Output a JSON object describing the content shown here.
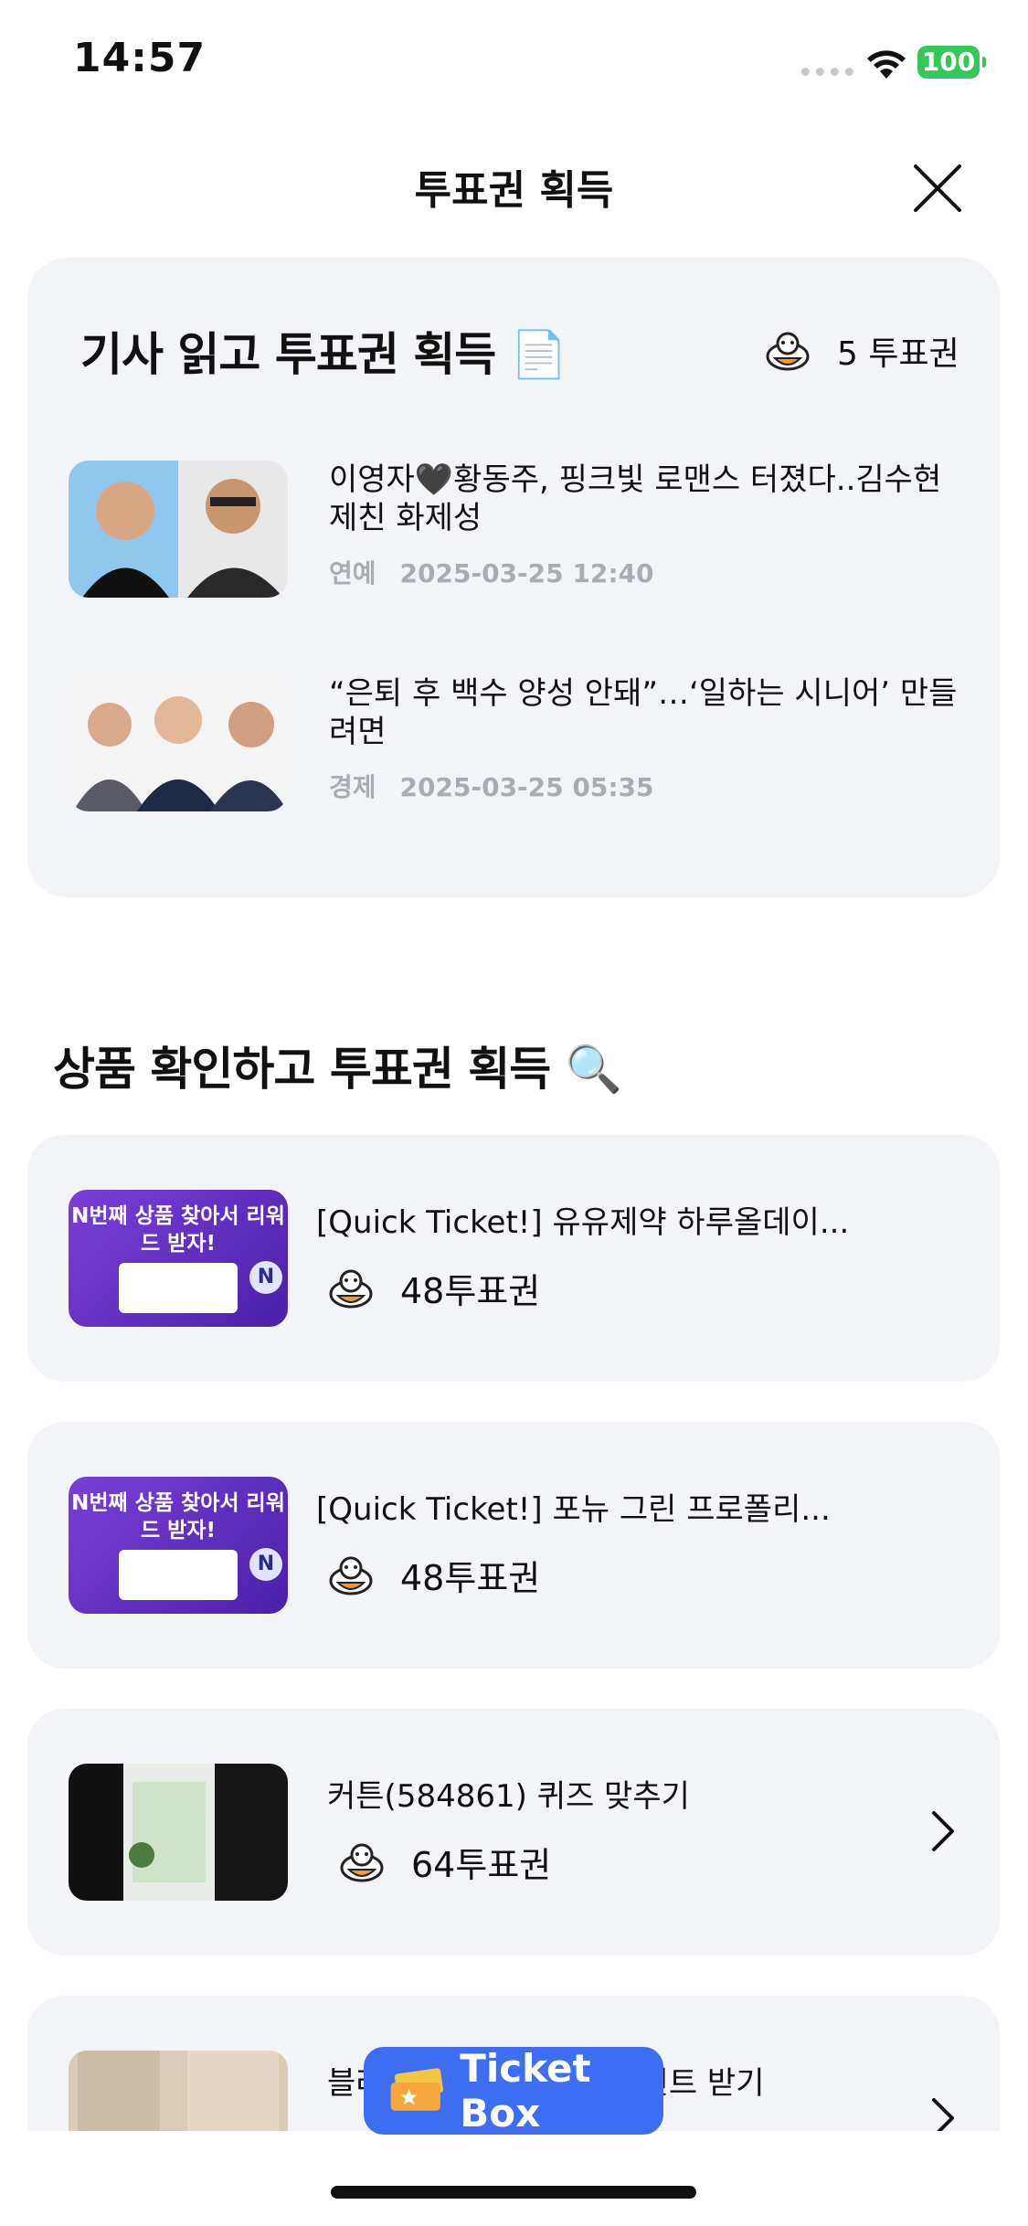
{
  "status": {
    "time": "14:57",
    "battery": "100"
  },
  "header": {
    "title": "투표권 획득"
  },
  "articles_section": {
    "title": "기사 읽고 투표권 획득 📄",
    "reward": "5 투표권",
    "items": [
      {
        "title": "이영자🖤황동주, 핑크빛 로맨스 터졌다..김수현 제친 화제성",
        "category": "연예",
        "datetime": "2025-03-25 12:40"
      },
      {
        "title": "“은퇴 후 백수 양성 안돼”…‘일하는 시니어’ 만들려면",
        "category": "경제",
        "datetime": "2025-03-25 05:35"
      }
    ]
  },
  "products_section": {
    "title": "상품 확인하고 투표권 획득 🔍",
    "promo_text": "N번째 상품 찾아서 리워드 받자!",
    "items": [
      {
        "title": "[Quick Ticket!] 유유제약 하루올데이...",
        "reward": "48투표권"
      },
      {
        "title": "[Quick Ticket!] 포뉴 그린 프로폴리...",
        "reward": "48투표권"
      },
      {
        "title": "커튼(584861) 퀴즈 맞추기",
        "reward": "64투표권"
      },
      {
        "title_left": "블라",
        "title_right": "인트 받기"
      }
    ]
  },
  "ticket_box": {
    "label": "Ticket Box"
  },
  "colors": {
    "card_bg": "#f3f4f8",
    "accent": "#3d6df2",
    "battery": "#34c759"
  }
}
